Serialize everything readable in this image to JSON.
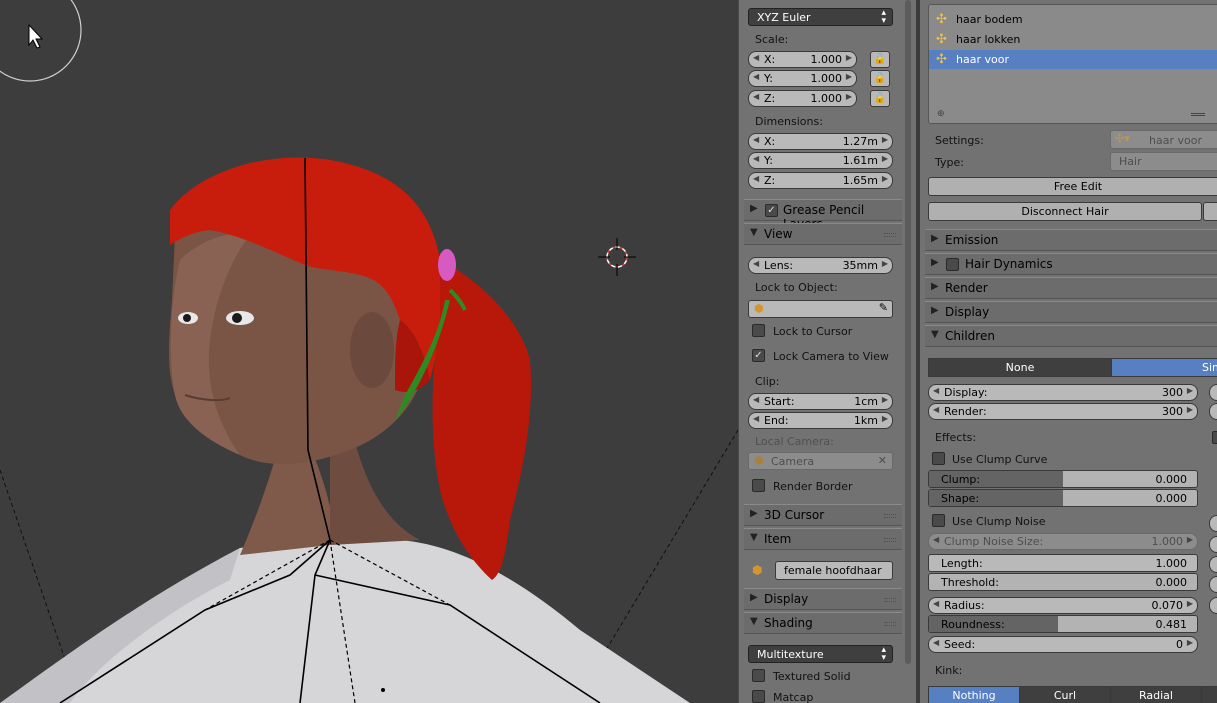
{
  "npanel": {
    "rotation_mode": "XYZ Euler",
    "scale_label": "Scale:",
    "scale": {
      "x_key": "X:",
      "x": "1.000",
      "y_key": "Y:",
      "y": "1.000",
      "z_key": "Z:",
      "z": "1.000"
    },
    "dimensions_label": "Dimensions:",
    "dimensions": {
      "x_key": "X:",
      "x": "1.27m",
      "y_key": "Y:",
      "y": "1.61m",
      "z_key": "Z:",
      "z": "1.65m"
    },
    "grease_pencil": "Grease Pencil Layers",
    "view_header": "View",
    "lens_key": "Lens:",
    "lens": "35mm",
    "lock_to_object": "Lock to Object:",
    "lock_to_cursor": "Lock to Cursor",
    "lock_camera_to_view": "Lock Camera to View",
    "clip_label": "Clip:",
    "clip_start_key": "Start:",
    "clip_start": "1cm",
    "clip_end_key": "End:",
    "clip_end": "1km",
    "local_camera_label": "Local Camera:",
    "camera_placeholder": "Camera",
    "render_border": "Render Border",
    "cursor_header": "3D Cursor",
    "item_header": "Item",
    "item_name": "female hoofdhaar",
    "display_header": "Display",
    "shading_header": "Shading",
    "shading_mode": "Multitexture",
    "textured_solid": "Textured Solid",
    "matcap": "Matcap"
  },
  "props": {
    "particle_systems": [
      {
        "name": "haar bodem",
        "selected": false
      },
      {
        "name": "haar lokken",
        "selected": false
      },
      {
        "name": "haar voor",
        "selected": true
      }
    ],
    "settings_label": "Settings:",
    "settings_value": "haar voor",
    "type_label": "Type:",
    "type_value": "Hair",
    "free_edit": "Free Edit",
    "disconnect_hair": "Disconnect Hair",
    "emission": "Emission",
    "hair_dynamics": "Hair Dynamics",
    "render": "Render",
    "display": "Display",
    "children": "Children",
    "children_none": "None",
    "children_simple": "Simple",
    "display_key": "Display:",
    "display_val": "300",
    "render_key": "Render:",
    "render_val": "300",
    "effects_label": "Effects:",
    "use_clump_curve": "Use Clump Curve",
    "clump_key": "Clump:",
    "clump_val": "0.000",
    "shape_key": "Shape:",
    "shape_val": "0.000",
    "use_clump_noise": "Use Clump Noise",
    "clump_noise_key": "Clump Noise Size:",
    "clump_noise_val": "1.000",
    "length_key": "Length:",
    "length_val": "1.000",
    "threshold_key": "Threshold:",
    "threshold_val": "0.000",
    "radius_key": "Radius:",
    "radius_val": "0.070",
    "roundness_key": "Roundness:",
    "roundness_val": "0.481",
    "roundness_fraction": 0.481,
    "clump_fraction": 0.5,
    "shape_fraction": 0.5,
    "seed_key": "Seed:",
    "seed_val": "0",
    "kink_label": "Kink:",
    "kink_nothing": "Nothing",
    "kink_curl": "Curl",
    "kink_radial": "Radial"
  }
}
